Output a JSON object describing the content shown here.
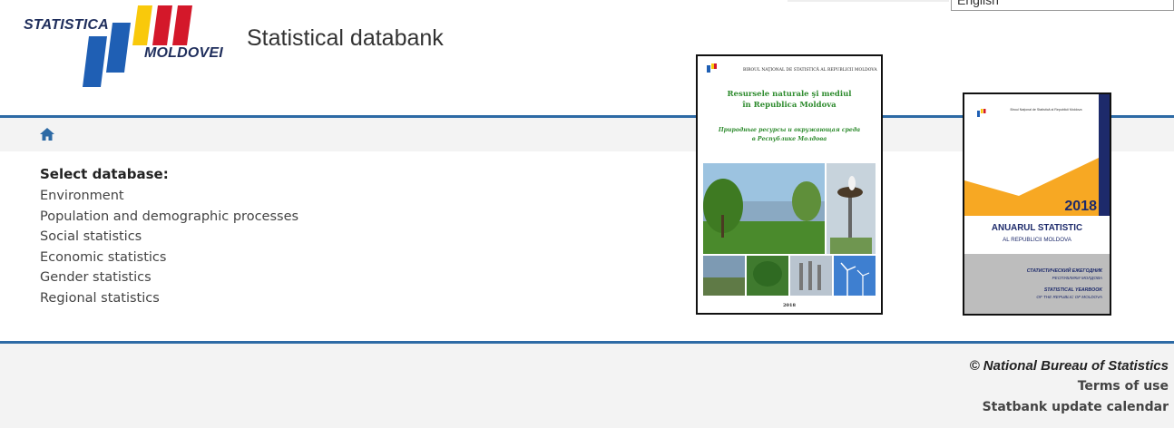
{
  "header": {
    "logo_line1": "STATISTICA",
    "logo_line2": "MOLDOVEI",
    "title": "Statistical databank",
    "language": "English"
  },
  "breadcrumb": {
    "icon": "home-icon"
  },
  "databases": {
    "heading": "Select database:",
    "items": [
      "Environment",
      "Population and demographic processes",
      "Social statistics",
      "Economic statistics",
      "Gender statistics",
      "Regional statistics"
    ]
  },
  "cover1": {
    "publisher": "BIROUL NAŢIONAL DE STATISTICĂ AL REPUBLICII MOLDOVA",
    "title_ro": "Resursele naturale şi mediul în Republica Moldova",
    "title_ru": "Природные ресурсы и окружающая среда в Республике Молдова",
    "year": "2018"
  },
  "cover2": {
    "publisher": "Biroul Naţional de Statistică al Republicii Moldova",
    "year": "2018",
    "title": "ANUARUL STATISTIC",
    "subtitle": "AL REPUBLICII MOLDOVA",
    "title_ru": "СТАТИСТИЧЕСКИЙ ЕЖЕГОДНИК",
    "subtitle_ru": "РЕСПУБЛИКИ МОЛДОВА",
    "title_en": "STATISTICAL YEARBOOK",
    "subtitle_en": "OF THE REPUBLIC OF MOLDOVA"
  },
  "footer": {
    "copyright": "© National Bureau of Statistics",
    "terms": "Terms of use",
    "calendar": "Statbank update calendar"
  },
  "colors": {
    "accent_blue": "#2d6aa5",
    "logo_blue": "#1f5fb4",
    "logo_yellow": "#f9c90b",
    "logo_red": "#d4182a",
    "cover_orange": "#f7a823",
    "cover_navy": "#1d2a6b",
    "cover_green": "#2e8b2e"
  }
}
